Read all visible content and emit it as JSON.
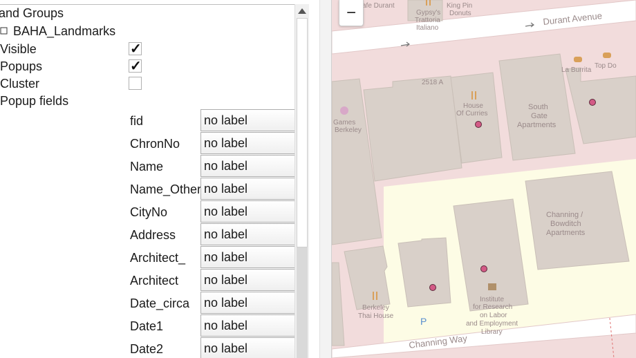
{
  "panel": {
    "heading": "and Groups",
    "layer_name": "BAHA_Landmarks",
    "visible_label": "Visible",
    "visible_checked": true,
    "popups_label": "Popups",
    "popups_checked": true,
    "cluster_label": "Cluster",
    "cluster_checked": false,
    "popup_fields_label": "Popup fields",
    "fields": [
      {
        "name": "fid",
        "value": "no label"
      },
      {
        "name": "ChronNo",
        "value": "no label"
      },
      {
        "name": "Name",
        "value": "no label"
      },
      {
        "name": "Name_Other",
        "value": "no label"
      },
      {
        "name": "CityNo",
        "value": "no label"
      },
      {
        "name": "Address",
        "value": "no label"
      },
      {
        "name": "Architect_",
        "value": "no label"
      },
      {
        "name": "Architect",
        "value": "no label"
      },
      {
        "name": "Date_circa",
        "value": "no label"
      },
      {
        "name": "Date1",
        "value": "no label"
      },
      {
        "name": "Date2",
        "value": "no label"
      }
    ]
  },
  "map": {
    "zoom_out": "−",
    "labels": {
      "cafe_durant": "afe Durant",
      "gypsys_1": "Gypsy's",
      "gypsys_2": "Trattoria",
      "gypsys_3": "Italiano",
      "kingpin_1": "King Pin",
      "kingpin_2": "Donuts",
      "durant_ave": "Durant Avenue",
      "addr_2518a": "2518 A",
      "la_burrita": "La Burrita",
      "top_dog": "Top Do",
      "games_1": "Games",
      "games_2": "Berkeley",
      "house_1": "House",
      "house_2": "Of Curries",
      "south_1": "South",
      "south_2": "Gate",
      "south_3": "Apartments",
      "channing_apts_1": "Channing /",
      "channing_apts_2": "Bowditch",
      "channing_apts_3": "Apartments",
      "thai_1": "Berkeley",
      "thai_2": "Thai House",
      "inst_1": "Institute",
      "inst_2": "for Research",
      "inst_3": "on Labor",
      "inst_4": "and Employment",
      "inst_5": "Library",
      "channing_way": "Channing Way",
      "parking": "P"
    },
    "colors": {
      "marker": "#d35a86",
      "building": "#d9d0c9",
      "background": "#f2dcdc",
      "campus": "#fdfce5"
    }
  }
}
